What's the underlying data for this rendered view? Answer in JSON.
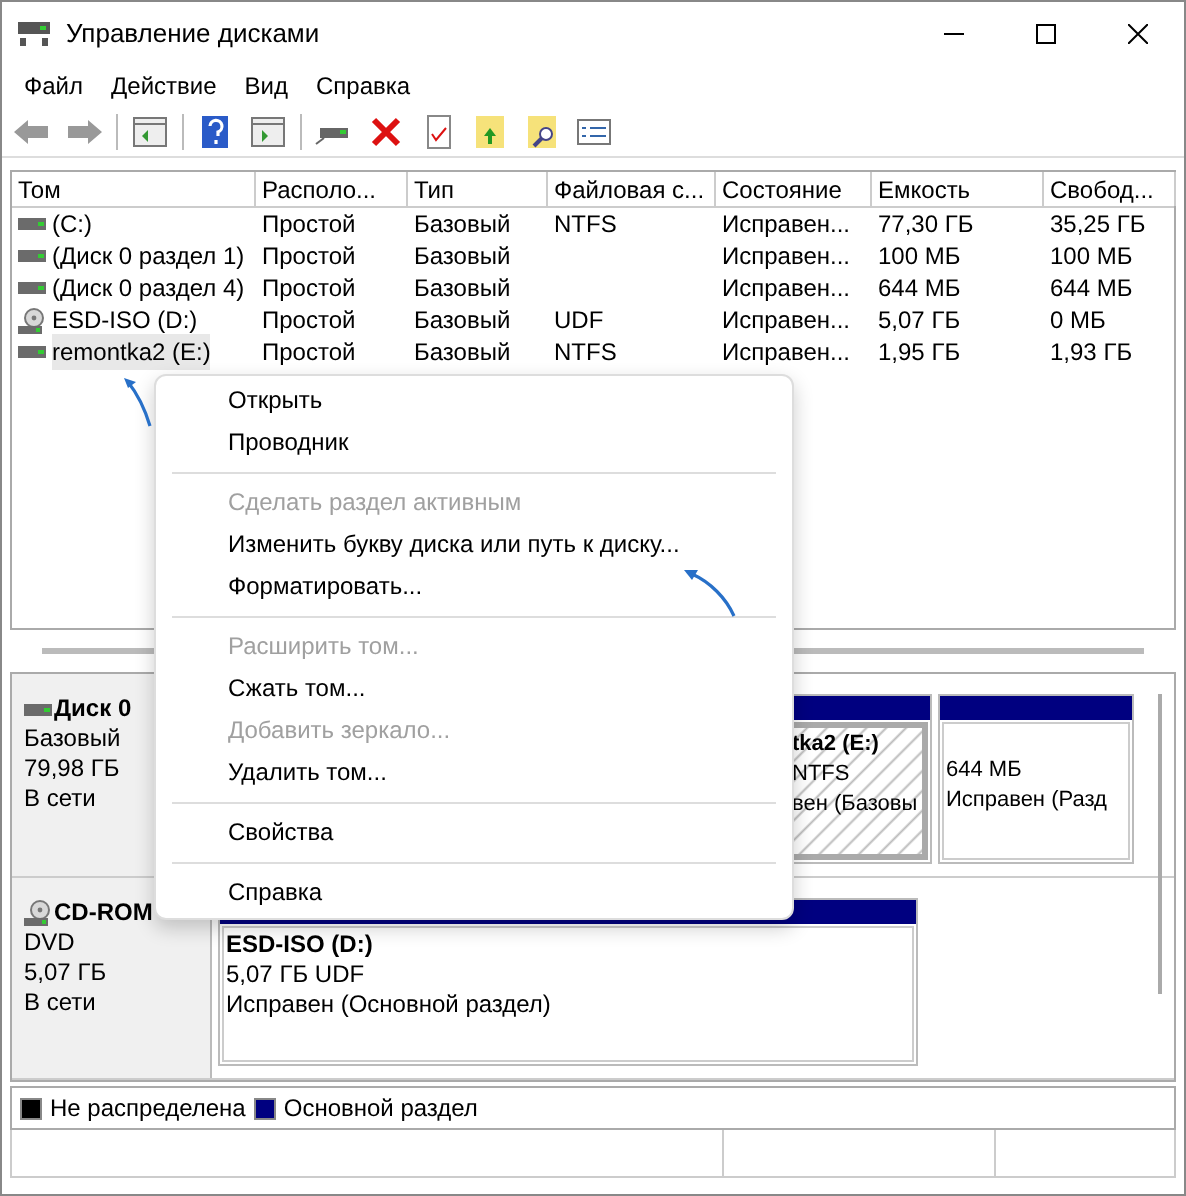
{
  "window": {
    "title": "Управление дисками"
  },
  "menu": [
    "Файл",
    "Действие",
    "Вид",
    "Справка"
  ],
  "volumes": {
    "columns": [
      "Том",
      "Располо...",
      "Тип",
      "Файловая с...",
      "Состояние",
      "Емкость",
      "Свобод..."
    ],
    "rows": [
      {
        "kind": "hdd",
        "selected": false,
        "cells": [
          "(C:)",
          "Простой",
          "Базовый",
          "NTFS",
          "Исправен...",
          "77,30 ГБ",
          "35,25 ГБ"
        ]
      },
      {
        "kind": "hdd",
        "selected": false,
        "cells": [
          "(Диск 0 раздел 1)",
          "Простой",
          "Базовый",
          "",
          "Исправен...",
          "100 МБ",
          "100 МБ"
        ]
      },
      {
        "kind": "hdd",
        "selected": false,
        "cells": [
          "(Диск 0 раздел 4)",
          "Простой",
          "Базовый",
          "",
          "Исправен...",
          "644 МБ",
          "644 МБ"
        ]
      },
      {
        "kind": "cd",
        "selected": false,
        "cells": [
          "ESD-ISO (D:)",
          "Простой",
          "Базовый",
          "UDF",
          "Исправен...",
          "5,07 ГБ",
          "0 МБ"
        ]
      },
      {
        "kind": "hdd",
        "selected": true,
        "cells": [
          "remontka2 (E:)",
          "Простой",
          "Базовый",
          "NTFS",
          "Исправен...",
          "1,95 ГБ",
          "1,93 ГБ"
        ]
      }
    ]
  },
  "context_menu": [
    {
      "kind": "item",
      "label": "Открыть",
      "disabled": false
    },
    {
      "kind": "item",
      "label": "Проводник",
      "disabled": false
    },
    {
      "kind": "separator"
    },
    {
      "kind": "item",
      "label": "Сделать раздел активным",
      "disabled": true
    },
    {
      "kind": "item",
      "label": "Изменить букву диска или путь к диску...",
      "disabled": false
    },
    {
      "kind": "item",
      "label": "Форматировать...",
      "disabled": false
    },
    {
      "kind": "separator"
    },
    {
      "kind": "item",
      "label": "Расширить том...",
      "disabled": true
    },
    {
      "kind": "item",
      "label": "Сжать том...",
      "disabled": false
    },
    {
      "kind": "item",
      "label": "Добавить зеркало...",
      "disabled": true
    },
    {
      "kind": "item",
      "label": "Удалить том...",
      "disabled": false
    },
    {
      "kind": "separator"
    },
    {
      "kind": "item",
      "label": "Свойства",
      "disabled": false
    },
    {
      "kind": "separator"
    },
    {
      "kind": "item",
      "label": "Справка",
      "disabled": false
    }
  ],
  "disks": [
    {
      "kind": "hdd",
      "name": "Диск 0",
      "lines": [
        "Базовый",
        "79,98 ГБ",
        "В сети"
      ],
      "partitions": [
        {
          "title": "tka2  (E:)",
          "lines": [
            "NTFS",
            "вен (Базовы"
          ],
          "selected": true
        },
        {
          "lines": [
            "644 МБ",
            "Исправен (Разд"
          ],
          "selected": false
        }
      ]
    },
    {
      "kind": "cd",
      "name": "CD-ROM",
      "lines": [
        "DVD",
        "5,07 ГБ",
        "В сети"
      ],
      "partitions": [
        {
          "title": "ESD-ISO  (D:)",
          "lines": [
            "5,07 ГБ UDF",
            "Исправен (Основной раздел)"
          ],
          "selected": false
        }
      ]
    }
  ],
  "legend": [
    {
      "label": "Не распределена",
      "color": "#000000"
    },
    {
      "label": "Основной раздел",
      "color": "#000080"
    }
  ]
}
